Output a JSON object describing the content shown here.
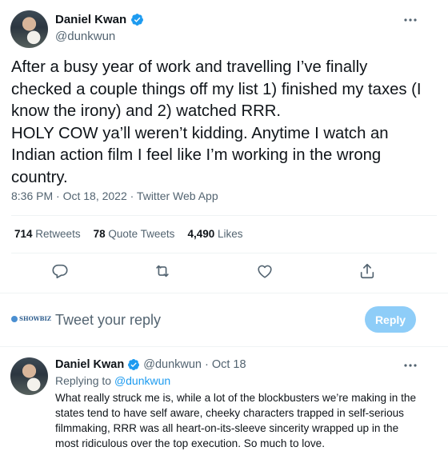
{
  "tweet": {
    "author_name": "Daniel Kwan",
    "author_handle": "@dunkwun",
    "text": "After a busy year of work and travelling I’ve finally checked a couple things off my list 1) finished my taxes (I know the irony) and 2) watched RRR.\nHOLY COW ya’ll weren’t kidding. Anytime I watch an Indian action film I feel like I’m working in the wrong country.",
    "timestamp": "8:36 PM · Oct 18, 2022 · Twitter Web App",
    "stats": {
      "retweets_count": "714",
      "retweets_label": "Retweets",
      "quotes_count": "78",
      "quotes_label": "Quote Tweets",
      "likes_count": "4,490",
      "likes_label": "Likes"
    },
    "actions": [
      "reply-icon",
      "retweet-icon",
      "like-icon",
      "share-icon"
    ]
  },
  "composer": {
    "brand": "SHOWBIZ",
    "placeholder": "Tweet your reply",
    "button_label": "Reply"
  },
  "reply": {
    "author_name": "Daniel Kwan",
    "author_handle": "@dunkwun",
    "separator": "·",
    "date": "Oct 18",
    "replying_to_label": "Replying to",
    "replying_to_handle": "@dunkwun",
    "text": "What really struck me is, while a lot of the blockbusters we’re making in the states tend to have self aware, cheeky characters trapped in self-serious filmmaking, RRR was all heart-on-its-sleeve sincerity wrapped up in the most ridiculous over the top execution. So much to love."
  },
  "colors": {
    "accent": "#1d9bf0",
    "reply_button": "#8ecdf8",
    "secondary_text": "#536471",
    "divider": "#eff3f4"
  }
}
